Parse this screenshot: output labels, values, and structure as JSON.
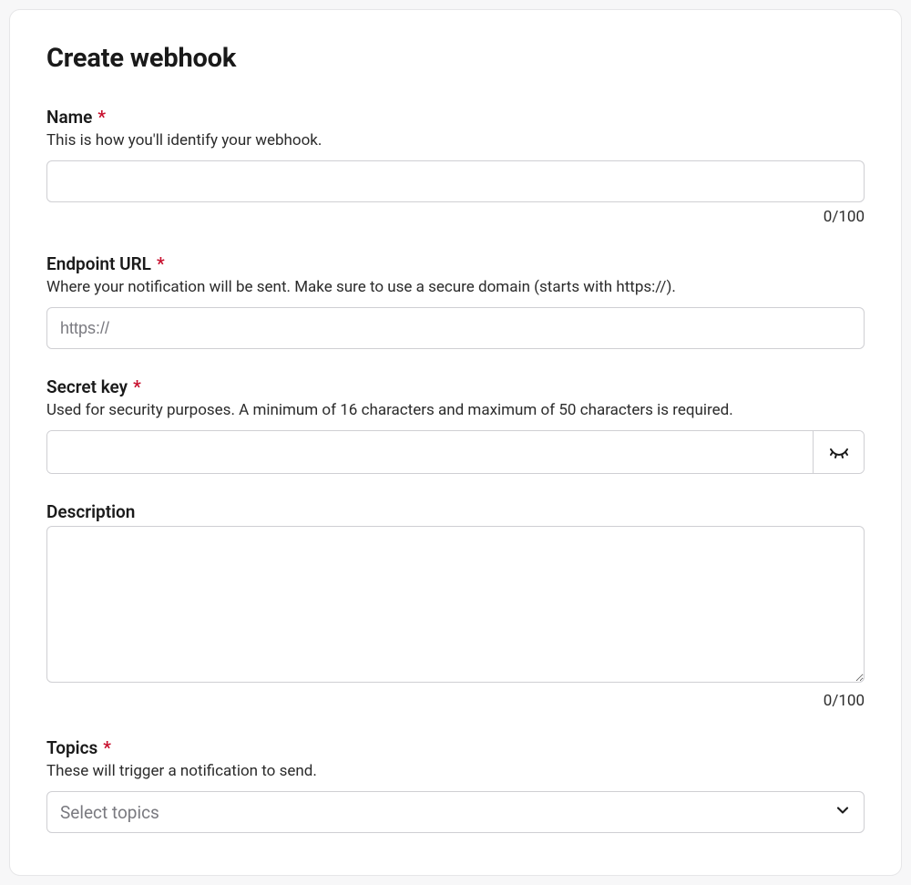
{
  "title": "Create webhook",
  "required_marker": "*",
  "fields": {
    "name": {
      "label": "Name",
      "help": "This is how you'll identify your webhook.",
      "value": "",
      "counter": "0/100"
    },
    "endpoint": {
      "label": "Endpoint URL",
      "help": "Where your notification will be sent. Make sure to use a secure domain (starts with https://).",
      "placeholder": "https://",
      "value": ""
    },
    "secret": {
      "label": "Secret key",
      "help": "Used for security purposes. A minimum of 16 characters and maximum of 50 characters is required.",
      "value": ""
    },
    "description": {
      "label": "Description",
      "value": "",
      "counter": "0/100"
    },
    "topics": {
      "label": "Topics",
      "help": "These will trigger a notification to send.",
      "placeholder": "Select topics"
    }
  }
}
